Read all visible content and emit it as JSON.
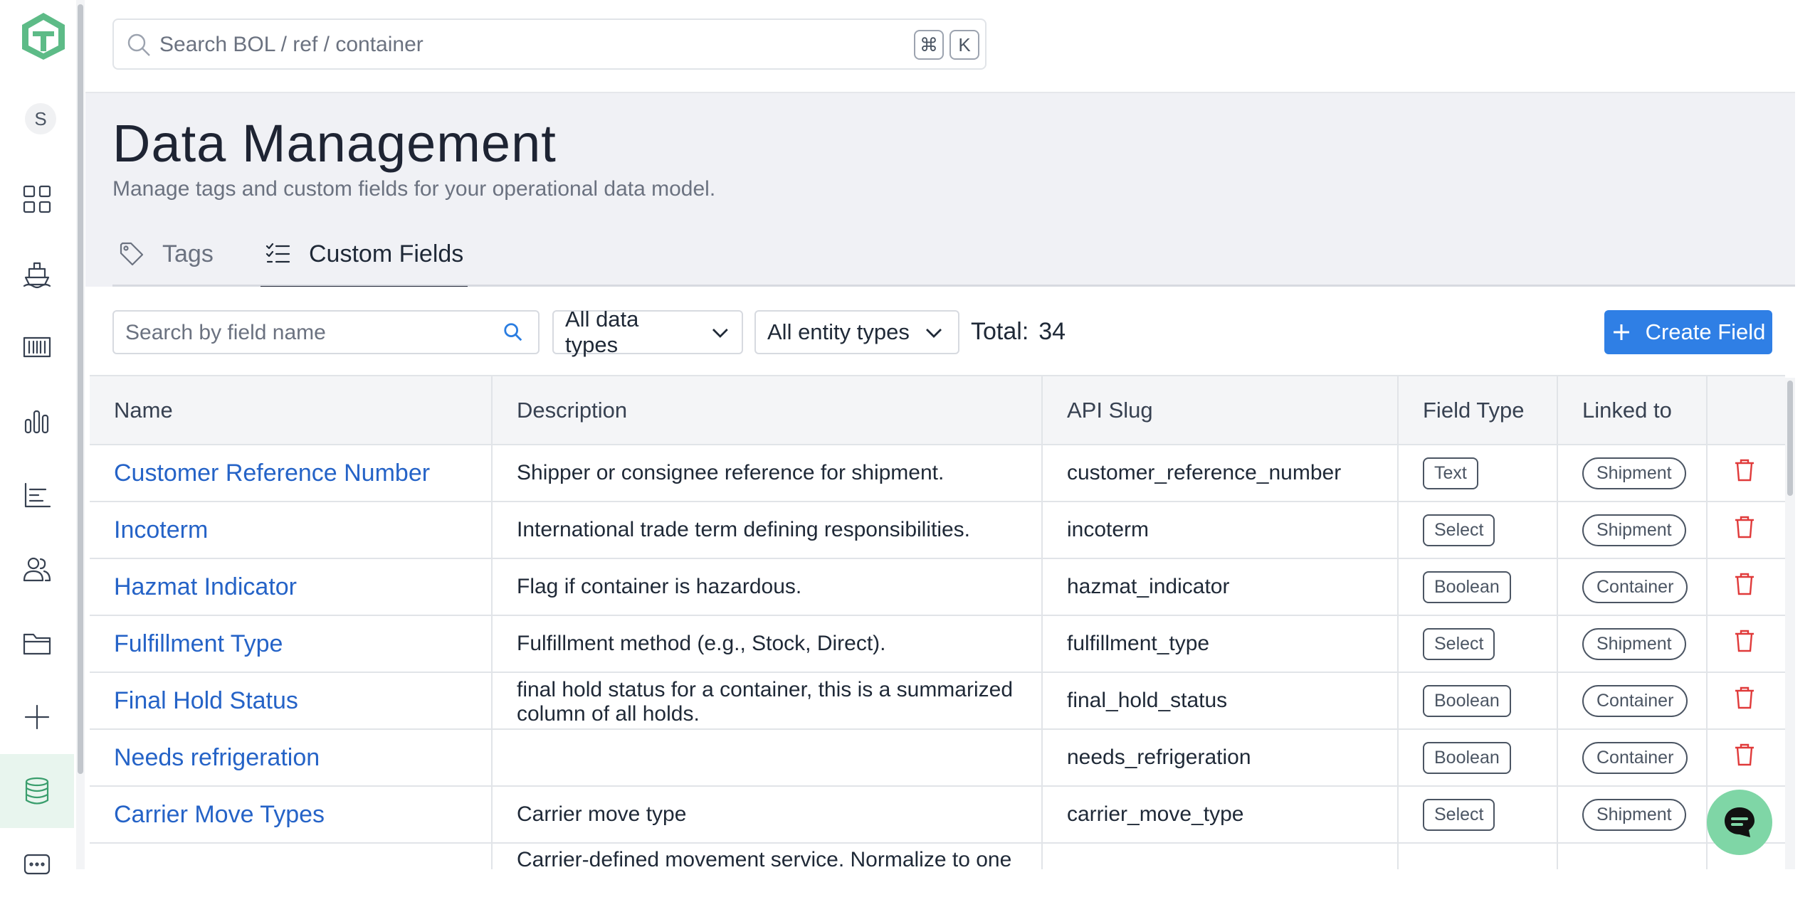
{
  "topbar": {
    "search_placeholder": "Search BOL / ref / container",
    "shortcut_cmd": "⌘",
    "shortcut_key": "K"
  },
  "sidebar": {
    "avatar_initial": "S",
    "items": [
      {
        "icon": "grid-icon"
      },
      {
        "icon": "ship-icon"
      },
      {
        "icon": "container-icon"
      },
      {
        "icon": "bar-chart-icon"
      },
      {
        "icon": "line-chart-icon"
      },
      {
        "icon": "users-icon"
      },
      {
        "icon": "folder-icon"
      },
      {
        "icon": "plus-icon"
      },
      {
        "icon": "database-icon",
        "active": true
      },
      {
        "icon": "chat-icon"
      }
    ],
    "accent_color": "#3a9e6d"
  },
  "page": {
    "title": "Data Management",
    "subtitle": "Manage tags and custom fields for your operational data model."
  },
  "tabs": [
    {
      "label": "Tags",
      "icon": "tag-icon",
      "active": false
    },
    {
      "label": "Custom Fields",
      "icon": "list-check-icon",
      "active": true
    }
  ],
  "toolbar": {
    "field_search_placeholder": "Search by field name",
    "data_types_selected": "All data types",
    "entity_types_selected": "All entity types",
    "total_label": "Total:",
    "total_count": "34",
    "create_label": "Create Field",
    "primary_color": "#2f7fe5"
  },
  "table": {
    "columns": [
      "Name",
      "Description",
      "API Slug",
      "Field Type",
      "Linked to",
      ""
    ],
    "rows": [
      {
        "name": "Customer Reference Number",
        "description": "Shipper or consignee reference for shipment.",
        "slug": "customer_reference_number",
        "type": "Text",
        "linked": "Shipment"
      },
      {
        "name": "Incoterm",
        "description": "International trade term defining responsibilities.",
        "slug": "incoterm",
        "type": "Select",
        "linked": "Shipment"
      },
      {
        "name": "Hazmat Indicator",
        "description": "Flag if container is hazardous.",
        "slug": "hazmat_indicator",
        "type": "Boolean",
        "linked": "Container"
      },
      {
        "name": "Fulfillment Type",
        "description": "Fulfillment method (e.g., Stock, Direct).",
        "slug": "fulfillment_type",
        "type": "Select",
        "linked": "Shipment"
      },
      {
        "name": "Final Hold Status",
        "description": "final hold status for a container, this is a summarized column of all holds.",
        "slug": "final_hold_status",
        "type": "Boolean",
        "linked": "Container"
      },
      {
        "name": "Needs refrigeration",
        "description": "",
        "slug": "needs_refrigeration",
        "type": "Boolean",
        "linked": "Container"
      },
      {
        "name": "Carrier Move Types",
        "description": "Carrier move type",
        "slug": "carrier_move_type",
        "type": "Select",
        "linked": "Shipment"
      },
      {
        "name": "",
        "description": "Carrier-defined movement service. Normalize to one",
        "slug": "",
        "type": "",
        "linked": ""
      }
    ]
  }
}
